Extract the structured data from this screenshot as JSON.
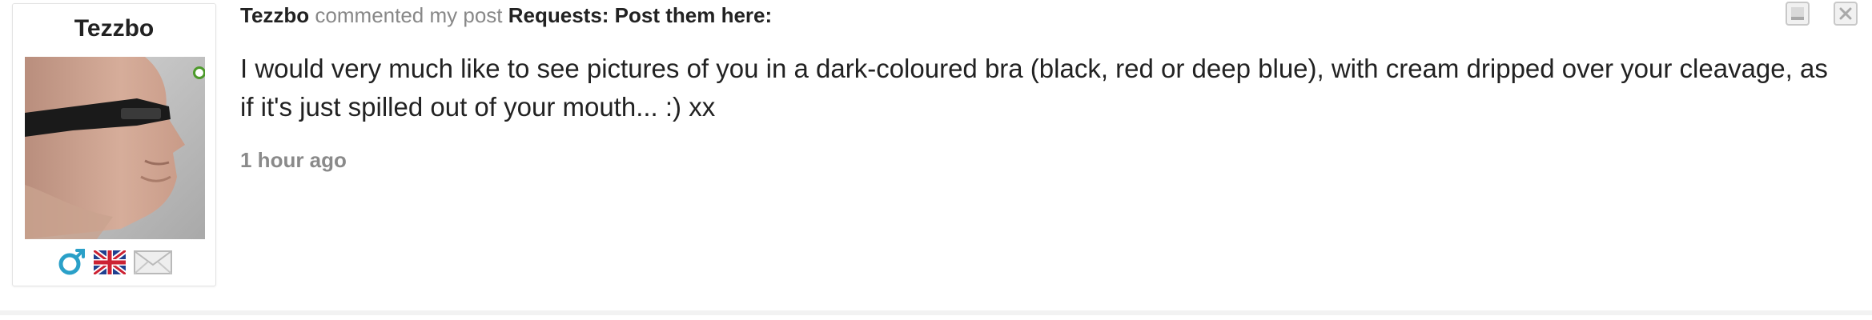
{
  "profile": {
    "name": "Tezzbo",
    "online_status": "online",
    "icons": [
      "male-gender-icon",
      "uk-flag-icon",
      "mail-icon"
    ]
  },
  "comment": {
    "actor": "Tezzbo",
    "verb": "commented my post",
    "post_title": "Requests: Post them here:",
    "body": "I would very much like to see pictures of you in a dark-coloured bra (black, red or deep blue), with cream dripped over your cleavage, as if it's just spilled out of your mouth... :) xx",
    "timestamp": "1 hour ago"
  },
  "actions": {
    "minimize_icon": "minimize-icon",
    "close_icon": "close-icon"
  },
  "colors": {
    "text": "#222222",
    "muted": "#888888",
    "online": "#4c9a2a",
    "gender_blue": "#2aa0c8"
  }
}
